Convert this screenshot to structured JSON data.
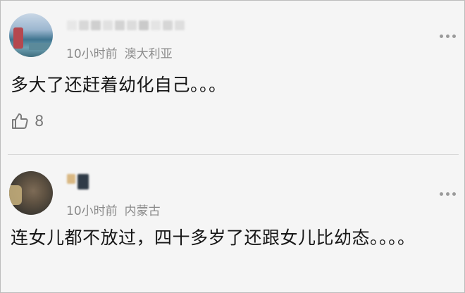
{
  "comments": [
    {
      "time": "10小时前",
      "location": "澳大利亚",
      "text": "多大了还赶着幼化自己。。。",
      "likes": "8",
      "name_blur_colors": [
        "#e7e7e7",
        "#d8d8d8",
        "#cfcfcf",
        "#e1e1e1",
        "#d3d3d3",
        "#dcdcdc",
        "#cacaca",
        "#e4e4e4",
        "#d6d6d6",
        "#dedede"
      ]
    },
    {
      "time": "10小时前",
      "location": "内蒙古",
      "text": "连女儿都不放过，四十多岁了还跟女儿比幼态。。。。",
      "name_blur_colors": [
        "#d9b883",
        "#2f3b47"
      ]
    }
  ],
  "icons": {
    "like": "thumbs-up-icon",
    "more": "more-dots-icon"
  }
}
